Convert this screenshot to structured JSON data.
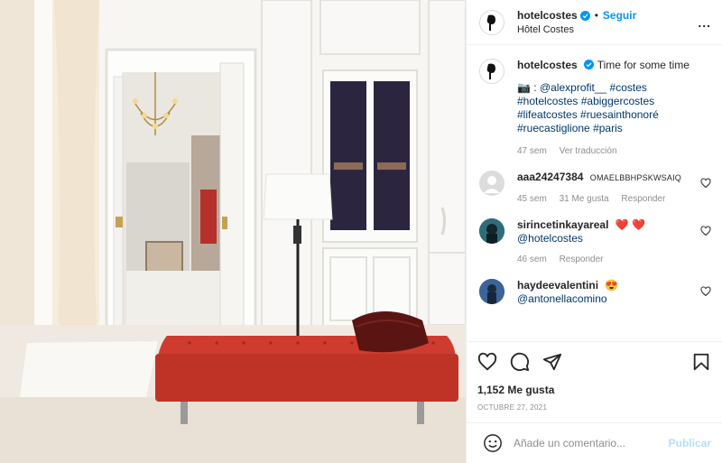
{
  "header": {
    "username": "hotelcostes",
    "dot": "•",
    "follow_label": "Seguir",
    "location": "Hôtel Costes",
    "more": "..."
  },
  "caption": {
    "username": "hotelcostes",
    "text": "Time for some time",
    "credit_prefix": "📷 : ",
    "credit_user": "@alexprofit__",
    "hashtags": [
      "#costes",
      "#hotelcostes",
      "#abiggercostes",
      "#lifeatcostes",
      "#ruesainthonoré",
      "#ruecastiglione",
      "#paris"
    ],
    "age": "47 sem",
    "translate": "Ver traducción"
  },
  "comments": [
    {
      "username": "aaa24247384",
      "text": "OMAELBBHPSKWSAIQ",
      "age": "45 sem",
      "likes": "31 Me gusta",
      "reply": "Responder"
    },
    {
      "username": "sirincetinkayareal",
      "text": "❤️ ❤️",
      "mention": "@hotelcostes",
      "age": "46 sem",
      "reply": "Responder"
    },
    {
      "username": "haydeevalentini",
      "text": "😍",
      "mention": "@antonellacomino"
    }
  ],
  "actions": {
    "likes": "1,152 Me gusta",
    "date": "OCTUBRE 27, 2021"
  },
  "add_comment": {
    "placeholder": "Añade un comentario...",
    "post_label": "Publicar"
  },
  "colors": {
    "accent": "#0095f6",
    "tag": "#00376b",
    "muted": "#8e8e8e",
    "like_red": "#ed4956",
    "sofa": "#c0352a"
  },
  "icons": [
    "verified-icon",
    "more-icon",
    "heart-icon",
    "comment-icon",
    "share-icon",
    "bookmark-icon",
    "emoji-icon"
  ]
}
